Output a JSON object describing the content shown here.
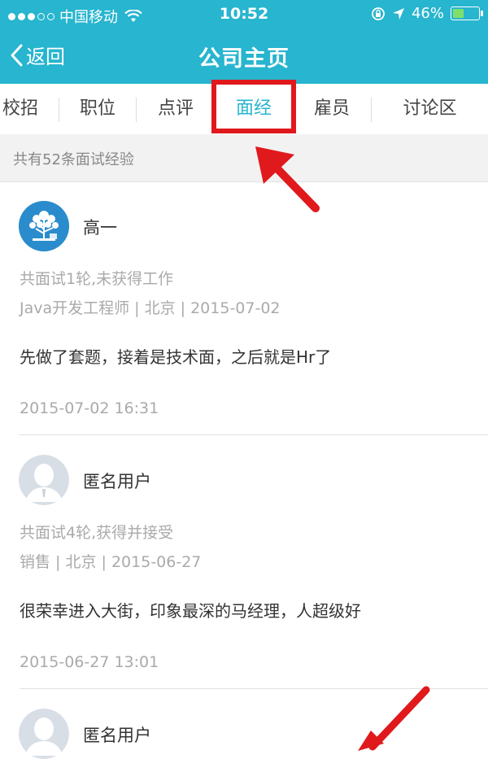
{
  "status_bar": {
    "carrier": "中国移动",
    "time": "10:52",
    "battery": "46%",
    "battery_level": 0.46,
    "signal_bars": 3
  },
  "nav": {
    "back_label": "返回",
    "title": "公司主页"
  },
  "tabs": [
    {
      "label": "校招"
    },
    {
      "label": "职位"
    },
    {
      "label": "点评"
    },
    {
      "label": "面经",
      "active": true
    },
    {
      "label": "雇员"
    },
    {
      "label": "讨论区"
    }
  ],
  "summary": "共有52条面试经验",
  "posts": [
    {
      "user": "高一",
      "avatar": "tree-logo-avatar",
      "result": "共面试1轮,未获得工作",
      "details": "Java开发工程师 | 北京 | 2015-07-02",
      "content": "先做了套题，接着是技术面，之后就是Hr了",
      "timestamp": "2015-07-02 16:31"
    },
    {
      "user": "匿名用户",
      "avatar": "default-user-avatar",
      "result": "共面试4轮,获得并接受",
      "details": "销售 | 北京 | 2015-06-27",
      "content": "很荣幸进入大街，印象最深的马经理，人超级好",
      "timestamp": "2015-06-27 13:01"
    },
    {
      "user": "匿名用户",
      "avatar": "default-user-avatar"
    }
  ],
  "colors": {
    "brand": "#27b5cf",
    "highlight": "#e0191d",
    "muted_text": "#aaaaaa"
  }
}
